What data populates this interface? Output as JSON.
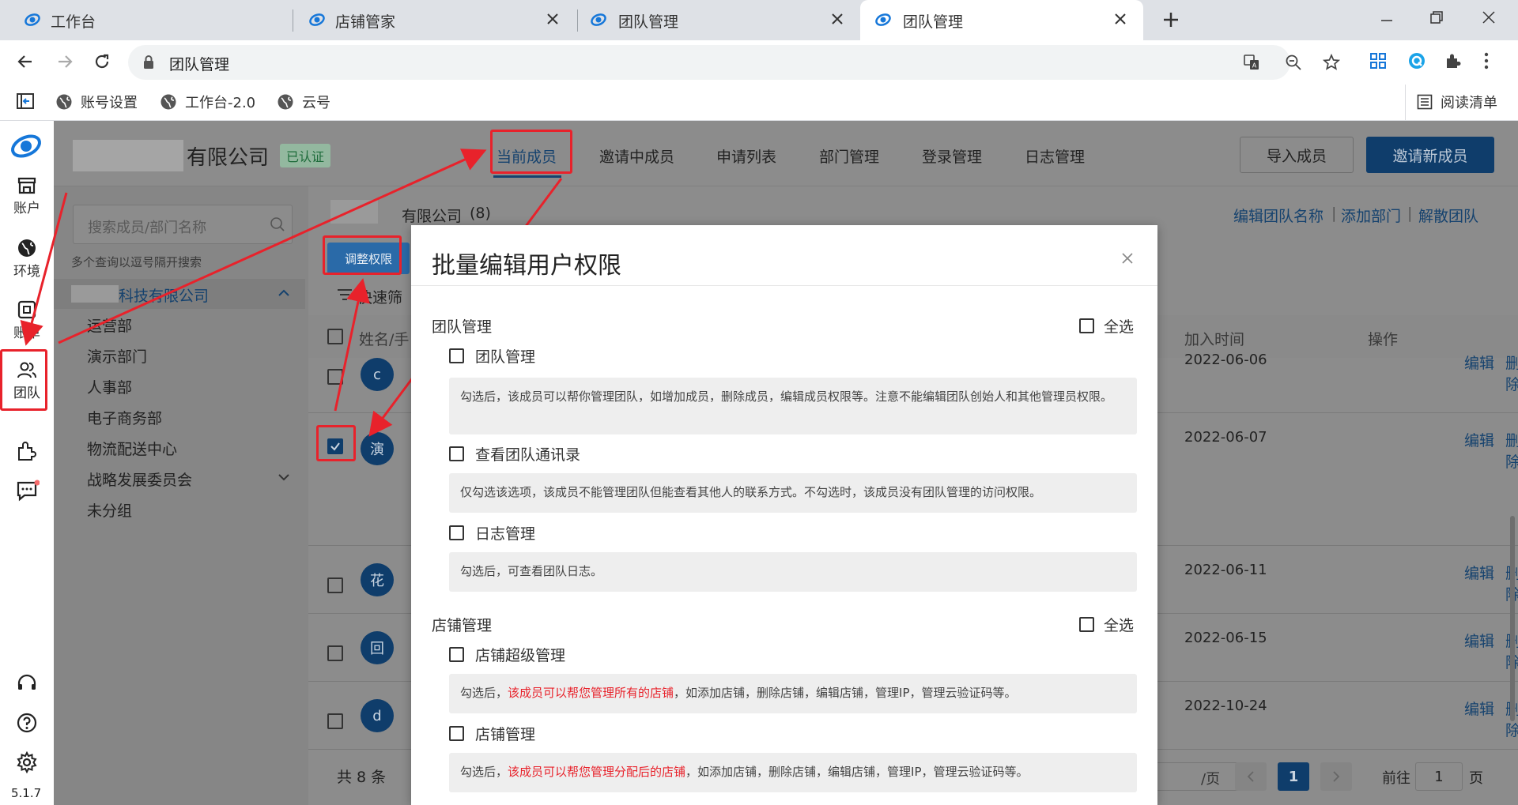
{
  "browser": {
    "tabs": [
      {
        "title": "工作台",
        "active": false
      },
      {
        "title": "店铺管家",
        "active": false
      },
      {
        "title": "团队管理",
        "active": false
      },
      {
        "title": "团队管理",
        "active": true
      }
    ],
    "address": "团队管理",
    "bookmarks": [
      "账号设置",
      "工作台-2.0",
      "云号"
    ],
    "reading_list": "阅读清单"
  },
  "rail": {
    "items": [
      "账户",
      "环境",
      "账单",
      "团队"
    ],
    "version": "5.1.7"
  },
  "header": {
    "company_name": "有限公司",
    "verified_badge": "已认证",
    "tabs": [
      "当前成员",
      "邀请中成员",
      "申请列表",
      "部门管理",
      "登录管理",
      "日志管理"
    ],
    "import_button": "导入成员",
    "invite_button": "邀请新成员"
  },
  "sidebar": {
    "search_placeholder": "搜索成员/部门名称",
    "search_hint": "多个查询以逗号隔开搜索",
    "root": "科技有限公司",
    "departments": [
      "运营部",
      "演示部门",
      "人事部",
      "电子商务部",
      "物流配送中心",
      "战略发展委员会",
      "未分组"
    ]
  },
  "main": {
    "team_title": "有限公司",
    "member_count": "(8)",
    "actions": [
      "编辑团队名称",
      "添加部门",
      "解散团队"
    ],
    "adjust_button": "调整权限",
    "quick_filter": "快速筛",
    "columns": {
      "name": "姓名/手",
      "join_time": "加入时间",
      "ops": "操作"
    },
    "rows": [
      {
        "avatar": "c",
        "date": "2022-06-06"
      },
      {
        "avatar": "演",
        "date": "2022-06-07"
      },
      {
        "avatar": "花",
        "date": "2022-06-11"
      },
      {
        "avatar": "回",
        "date": "2022-06-15"
      },
      {
        "avatar": "d",
        "date": "2022-10-24"
      }
    ],
    "edit_label": "编辑",
    "delete_label": "删除",
    "total": "共 8 条",
    "page_size_suffix": "/页",
    "current_page": "1",
    "goto_label": "前往",
    "goto_value": "1",
    "page_unit": "页"
  },
  "modal": {
    "title": "批量编辑用户权限",
    "select_all": "全选",
    "sections": [
      {
        "title": "团队管理",
        "items": [
          {
            "label": "团队管理",
            "desc": "勾选后，该成员可以帮你管理团队，如增加成员，删除成员，编辑成员权限等。注意不能编辑团队创始人和其他管理员权限。"
          },
          {
            "label": "查看团队通讯录",
            "desc": "仅勾选该选项，该成员不能管理团队但能查看其他人的联系方式。不勾选时，该成员没有团队管理的访问权限。"
          },
          {
            "label": "日志管理",
            "desc": "勾选后，可查看团队日志。"
          }
        ]
      },
      {
        "title": "店铺管理",
        "items": [
          {
            "label": "店铺超级管理",
            "desc_pre": "勾选后，",
            "desc_red": "该成员可以帮您管理所有的店铺",
            "desc_post": "，如添加店铺，删除店铺，编辑店铺，管理IP，管理云验证码等。"
          },
          {
            "label": "店铺管理",
            "desc_pre": "勾选后，",
            "desc_red": "该成员可以帮您管理分配后的店铺",
            "desc_post": "，如添加店铺，删除店铺，编辑店铺，管理IP，管理云验证码等。"
          }
        ]
      }
    ]
  },
  "colors": {
    "accent": "#1677d9",
    "annotation_red": "#e8222b",
    "overlay": "#8c8c8c"
  }
}
